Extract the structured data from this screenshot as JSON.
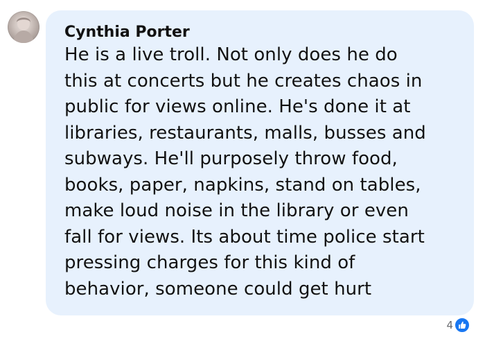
{
  "comment": {
    "author": "Cynthia Porter",
    "lines": [
      "He is a live troll. Not only does he do",
      "this at concerts but he creates chaos in",
      "public for views online. He's done it at",
      "libraries, restaurants, malls, busses and",
      "subways. He'll purposely throw food,",
      "books, paper, napkins, stand on tables,",
      "make loud noise in the library or even",
      "fall for views. Its about time police start",
      "pressing charges for this kind of",
      "behavior, someone could get hurt"
    ]
  },
  "reactions": {
    "count": "4",
    "icon": "like-icon",
    "like_color": "#1877f2"
  },
  "colors": {
    "bubble_background": "#e7f1fd",
    "text": "#121212"
  }
}
